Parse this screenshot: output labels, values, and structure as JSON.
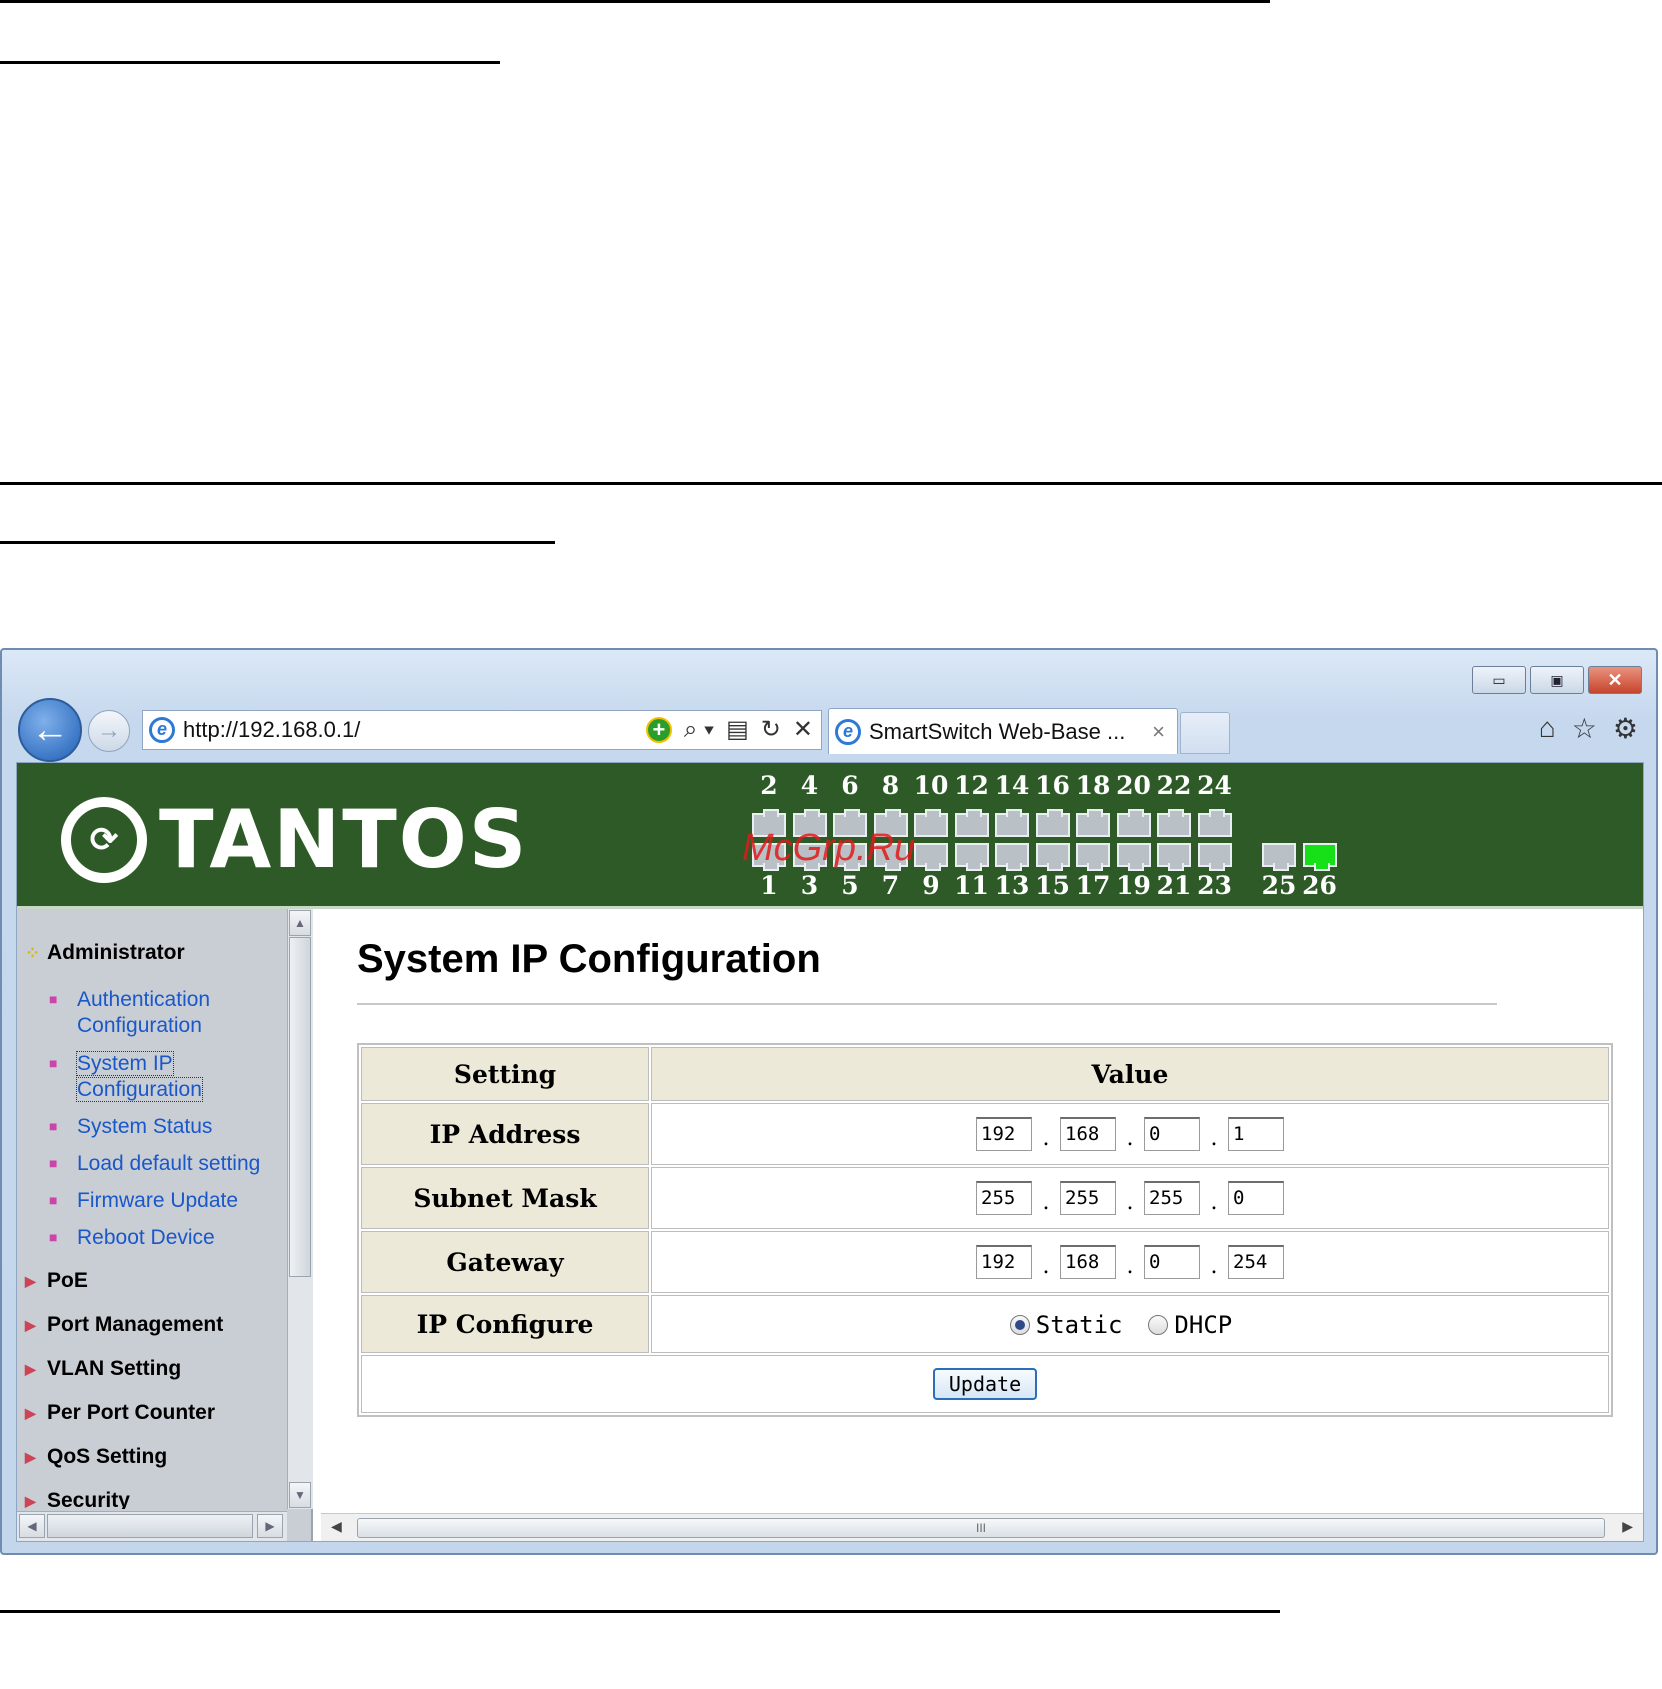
{
  "browser": {
    "address": "http://192.168.0.1/",
    "tab_title": "SmartSwitch Web-Base ...",
    "tab_close": "×",
    "window_buttons": {
      "minimize": "▭",
      "maximize": "▣",
      "close": "✕"
    },
    "nav": {
      "back": "←",
      "forward": "→"
    },
    "addr_tools": {
      "add": "+",
      "search": "⌕ ▾",
      "compat": "▤",
      "refresh": "↻",
      "stop": "✕"
    },
    "toolbar_icons": {
      "home": "⌂",
      "favorites": "☆",
      "tools": "⚙"
    }
  },
  "banner": {
    "logo_text": "TANTOS",
    "top_port_numbers": [
      "2",
      "4",
      "6",
      "8",
      "10",
      "12",
      "14",
      "16",
      "18",
      "20",
      "22",
      "24"
    ],
    "bottom_port_numbers": [
      "1",
      "3",
      "5",
      "7",
      "9",
      "11",
      "13",
      "15",
      "17",
      "19",
      "21",
      "23"
    ],
    "uplink_numbers": [
      "25",
      "26"
    ],
    "active_port": "26",
    "active_color": "#18e018",
    "watermark": "McGrp.Ru"
  },
  "sidebar": {
    "sections": [
      {
        "label": "Administrator",
        "expanded": true
      },
      {
        "label": "PoE"
      },
      {
        "label": "Port Management"
      },
      {
        "label": "VLAN Setting"
      },
      {
        "label": "Per Port Counter"
      },
      {
        "label": "QoS Setting"
      },
      {
        "label": "Security"
      }
    ],
    "admin_items": [
      {
        "line1": "Authentication",
        "line2": "Configuration"
      },
      {
        "line1": "System IP",
        "line2": "Configuration",
        "selected": true
      },
      {
        "line1": "System Status"
      },
      {
        "line1": "Load default setting"
      },
      {
        "line1": "Firmware Update"
      },
      {
        "line1": "Reboot Device"
      }
    ],
    "link_color": "#1a57c9"
  },
  "main": {
    "title": "System IP Configuration",
    "table": {
      "header_setting": "Setting",
      "header_value": "Value",
      "ip_label": "IP Address",
      "ip": [
        "192",
        "168",
        "0",
        "1"
      ],
      "mask_label": "Subnet Mask",
      "mask": [
        "255",
        "255",
        "255",
        "0"
      ],
      "gateway_label": "Gateway",
      "gateway": [
        "192",
        "168",
        "0",
        "254"
      ],
      "mode_label": "IP Configure",
      "mode_static": "Static",
      "mode_dhcp": "DHCP",
      "mode_selected": "Static",
      "update_label": "Update"
    },
    "scroll_grip": "III"
  }
}
